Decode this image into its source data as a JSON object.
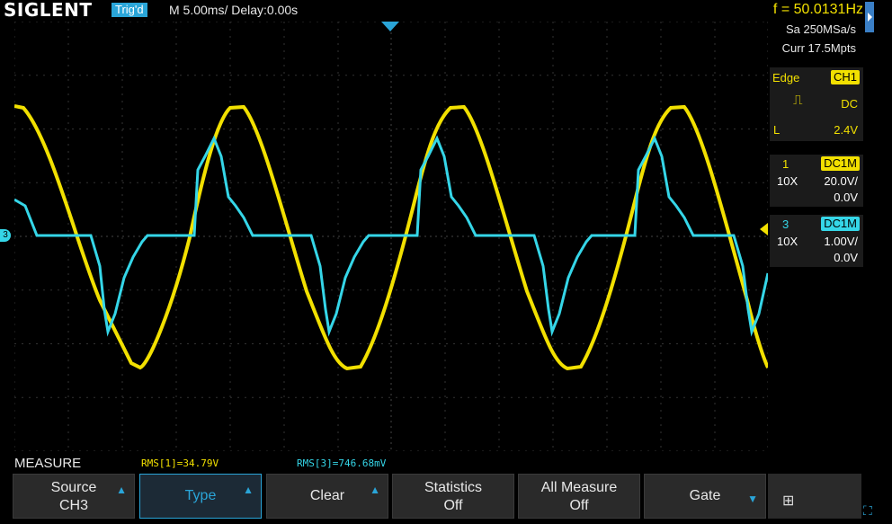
{
  "header": {
    "brand": "SIGLENT",
    "trig_status": "Trig'd",
    "timebase": "M 5.00ms/ Delay:0.00s",
    "frequency": "f = 50.0131Hz"
  },
  "acquisition": {
    "sample_rate": "Sa 250MSa/s",
    "memory": "Curr 17.5Mpts"
  },
  "trigger": {
    "type": "Edge",
    "source": "CH1",
    "slope_icon": "rising-edge-icon",
    "coupling": "DC",
    "level_label": "L",
    "level": "2.4V"
  },
  "channels": [
    {
      "id": "1",
      "coupling": "DC1M",
      "probe": "10X",
      "scale": "20.0V/",
      "offset": "0.0V",
      "color": "#f2e000"
    },
    {
      "id": "3",
      "coupling": "DC1M",
      "probe": "10X",
      "scale": "1.00V/",
      "offset": "0.0V",
      "color": "#35d6e8"
    }
  ],
  "markers": {
    "ch3": "3"
  },
  "measure": {
    "title": "MEASURE",
    "rms1": "RMS[1]=34.79V",
    "rms3": "RMS[3]=746.68mV"
  },
  "softkeys": [
    {
      "line1": "Source",
      "line2": "CH3",
      "arrow": "up"
    },
    {
      "line1": "Type",
      "line2": "",
      "arrow": "up",
      "selected": true
    },
    {
      "line1": "Clear",
      "line2": "",
      "arrow": "up"
    },
    {
      "line1": "Statistics",
      "line2": "Off",
      "arrow": ""
    },
    {
      "line1": "All Measure",
      "line2": "Off",
      "arrow": ""
    },
    {
      "line1": "Gate",
      "line2": "",
      "arrow": "down"
    }
  ],
  "colors": {
    "ch1": "#f2e000",
    "ch3": "#35d6e8",
    "accent": "#2aa5d8"
  }
}
